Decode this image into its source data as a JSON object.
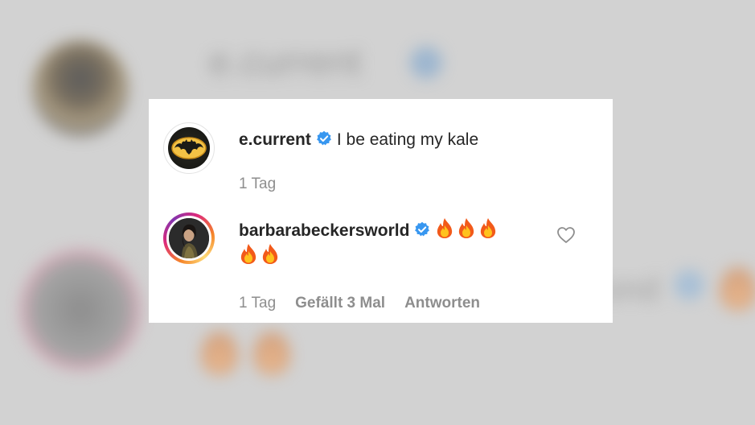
{
  "background": {
    "blurred_text_1": "e.current",
    "blurred_text_2": "I be eating my",
    "blurred_text_3": "ond"
  },
  "comments": [
    {
      "username": "e.current",
      "verified": true,
      "text": "I be eating my kale",
      "timestamp": "1 Tag",
      "avatar_icon": "batman-logo-icon"
    },
    {
      "username": "barbarabeckersworld",
      "verified": true,
      "flames_line1_count": 3,
      "flames_line2_count": 2,
      "flame_icon": "fire-emoji-icon",
      "timestamp": "1 Tag",
      "likes": "Gefällt 3 Mal",
      "reply": "Antworten",
      "like_icon": "heart-outline-icon",
      "avatar_icon": "profile-photo-icon"
    }
  ],
  "colors": {
    "verified_blue": "#3897f0",
    "meta_gray": "#8e8e8e",
    "text_dark": "#262626"
  }
}
